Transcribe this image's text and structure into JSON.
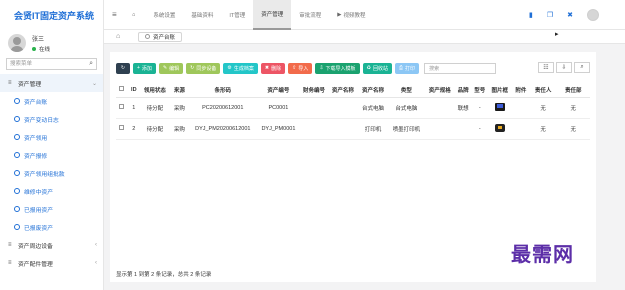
{
  "app": {
    "title": "会贤IT固定资产系统"
  },
  "user": {
    "name": "张三",
    "status": "在线"
  },
  "sidebar": {
    "search_placeholder": "搜索菜单",
    "sections": [
      {
        "label": "资产管理",
        "icon": "list-icon",
        "arrow": "⌄"
      },
      {
        "label": "资产周边设备",
        "icon": "list-icon",
        "arrow": "‹"
      },
      {
        "label": "资产配件管理",
        "icon": "list-icon",
        "arrow": "‹"
      }
    ],
    "subitems": [
      "资产台账",
      "资产变动日志",
      "资产领用",
      "资产报修",
      "资产领用组批款",
      "维修中资产",
      "已报用资产",
      "已报废资产"
    ]
  },
  "topnav": {
    "tabs": [
      "系统设置",
      "基础资料",
      "IT管理",
      "资产管理",
      "审批流程",
      "视频教程"
    ],
    "active": "资产管理"
  },
  "breadcrumb": {
    "tab": "资产台账"
  },
  "toolbar": {
    "buttons": [
      "添加",
      "编辑",
      "同步设备",
      "生成档案",
      "删除",
      "导入",
      "下载导入模板",
      "回收站",
      "打印"
    ],
    "search_placeholder": "搜索"
  },
  "table": {
    "columns": [
      "",
      "ID",
      "领用状态",
      "来源",
      "条形码",
      "资产编号",
      "财务编号",
      "资产名称",
      "资产名称",
      "类型",
      "资产规格",
      "品牌",
      "型号",
      "图片框",
      "附件",
      "责任人",
      "责任部"
    ],
    "rows": [
      {
        "id": "1",
        "status": "待分配",
        "source": "采购",
        "barcode": "PC20200612001",
        "asset_no": "PC0001",
        "finance_no": "",
        "name1": "",
        "name2": "台式电脑",
        "type": "台式电脑",
        "spec": "",
        "brand": "联想",
        "model": "-",
        "image": "pc",
        "attach": "",
        "owner": "无",
        "dept": "无"
      },
      {
        "id": "2",
        "status": "待分配",
        "source": "采购",
        "barcode": "DYJ_PM20200612001",
        "asset_no": "DYJ_PM0001",
        "finance_no": "",
        "name1": "",
        "name2": "打印机",
        "type": "喷墨打印机",
        "spec": "",
        "brand": "",
        "model": "-",
        "image": "printer",
        "attach": "",
        "owner": "无",
        "dept": "无"
      }
    ]
  },
  "footer": {
    "text": "显示第 1 到第 2 条记录，总共 2 条记录"
  },
  "watermark": {
    "text": "最需网"
  },
  "colors": {
    "brand": "#1f6fd6",
    "online": "#2ab24c",
    "add": "#1ab394",
    "delete": "#ed5565",
    "import": "#f26b4b"
  }
}
